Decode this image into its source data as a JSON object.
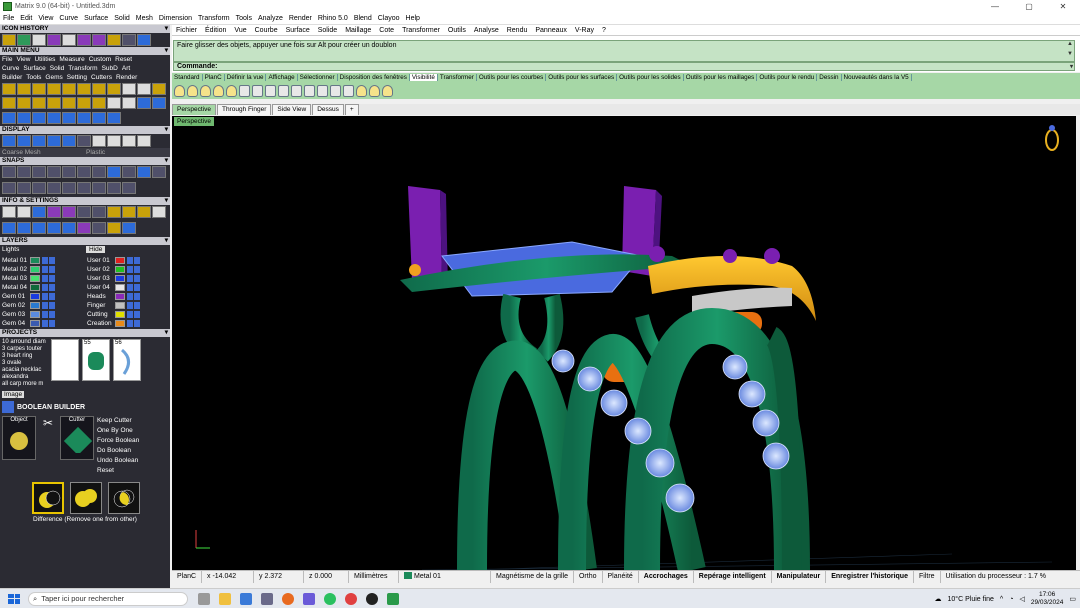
{
  "window": {
    "title": "Matrix 9.0 (64-bit) - Untitled.3dm",
    "controls": [
      "—",
      "▢",
      "✕"
    ]
  },
  "app_menu": [
    "File",
    "Edit",
    "View",
    "Curve",
    "Surface",
    "Solid",
    "Mesh",
    "Dimension",
    "Transform",
    "Tools",
    "Analyze",
    "Render",
    "Rhino 5.0",
    "Blend",
    "Clayoo",
    "Help"
  ],
  "left_panel": {
    "icon_history": "ICON HISTORY",
    "main_menu": "MAIN MENU",
    "main_menu_row1": [
      "File",
      "View",
      "Utilities",
      "Measure",
      "Custom",
      "Reset"
    ],
    "main_menu_row2": [
      "Curve",
      "Surface",
      "Solid",
      "Transform",
      "SubD",
      "Art"
    ],
    "main_menu_row3": [
      "Builder",
      "Tools",
      "Gems",
      "Setting",
      "Cutters",
      "Render"
    ],
    "display": "DISPLAY",
    "display_modes": [
      "Coarse Mesh",
      "Plastic"
    ],
    "snaps": "SNAPS",
    "info_settings": "INFO & SETTINGS",
    "layers_title": "LAYERS",
    "layers_header": [
      "Lights",
      "Hide"
    ],
    "layers": [
      {
        "name": "Metal 01",
        "color": "#1b8a5a"
      },
      {
        "name": "User 01",
        "color": "#e02020"
      },
      {
        "name": "Metal 02",
        "color": "#2ecc71"
      },
      {
        "name": "User 02",
        "color": "#20c020"
      },
      {
        "name": "Metal 03",
        "color": "#48e070"
      },
      {
        "name": "User 03",
        "color": "#1a3ae0"
      },
      {
        "name": "Metal 04",
        "color": "#0f6a3a"
      },
      {
        "name": "User 04",
        "color": "#e8e8e8"
      },
      {
        "name": "Gem 01",
        "color": "#1a3ae0"
      },
      {
        "name": "Heads",
        "color": "#8a2ab9"
      },
      {
        "name": "Gem 02",
        "color": "#2a7ad0"
      },
      {
        "name": "Finger",
        "color": "#c0c0c0"
      },
      {
        "name": "Gem 03",
        "color": "#5a8ae0"
      },
      {
        "name": "Cutting",
        "color": "#e0e000"
      },
      {
        "name": "Gem 04",
        "color": "#3a5ab0"
      },
      {
        "name": "Creation",
        "color": "#e88a1a"
      }
    ],
    "projects_title": "PROJECTS",
    "projects_list": [
      "10 arround diam",
      "3 carpes touter",
      "3 heart ring",
      "3 ovale",
      "acacia necklac",
      "alexandra",
      "all carp more m"
    ],
    "project_thumbs": [
      "",
      "55",
      "56"
    ],
    "project_image_btn": "Image",
    "boolean_title": "BOOLEAN BUILDER",
    "boolean_object": "Object",
    "boolean_cutter": "Cutter",
    "boolean_options": [
      "Keep Cutter",
      "One By One",
      "Force Boolean",
      "Do Boolean",
      "Undo Boolean",
      "Reset"
    ],
    "boolean_caption": "Difference (Remove one from other)"
  },
  "rhino_menu": [
    "Fichier",
    "Édition",
    "Vue",
    "Courbe",
    "Surface",
    "Solide",
    "Maillage",
    "Cote",
    "Transformer",
    "Outils",
    "Analyse",
    "Rendu",
    "Panneaux",
    "V-Ray",
    "?"
  ],
  "history_text": "Faire glisser des objets, appuyer une fois sur Alt pour créer un doublon",
  "command_label": "Commande:",
  "toolbar_tabs": [
    "Standard",
    "PlanC",
    "Définir la vue",
    "Affichage",
    "Sélectionner",
    "Disposition des fenêtres",
    "Visibilité",
    "Transformer",
    "Outils pour les courbes",
    "Outils pour les surfaces",
    "Outils pour les solides",
    "Outils pour les maillages",
    "Outils pour le rendu",
    "Dessin",
    "Nouveautés dans la V5"
  ],
  "active_tab": "Visibilité",
  "viewport_tabs": [
    "Perspective",
    "Through Finger",
    "Side View",
    "Dessus",
    "+"
  ],
  "viewport_label": "Perspective",
  "status": {
    "plane": "PlanC",
    "x": "x -14.042",
    "y": "y 2.372",
    "z": "z 0.000",
    "units": "Millimètres",
    "layer": "Metal 01",
    "grid_snap": "Magnétisme de la grille",
    "ortho": "Ortho",
    "planar": "Planéité",
    "osnap": "Accrochages",
    "smarttrack": "Repérage intelligent",
    "gumball": "Manipulateur",
    "history": "Enregistrer l'historique",
    "filter": "Filtre",
    "cpu": "Utilisation du processeur : 1.7 %"
  },
  "taskbar": {
    "search_placeholder": "Taper ici pour rechercher",
    "weather": "10°C  Pluie fine",
    "time": "17:06",
    "date": "29/03/2024"
  }
}
